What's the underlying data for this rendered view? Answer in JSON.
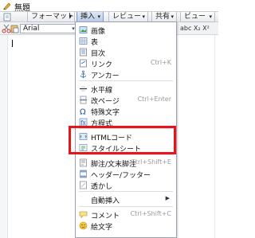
{
  "window": {
    "title": "無題"
  },
  "menubar": {
    "items": [
      {
        "label": "フォーマット"
      },
      {
        "label": "挿入"
      },
      {
        "label": "レビュー"
      },
      {
        "label": "共有"
      },
      {
        "label": "ビュー"
      }
    ]
  },
  "toolbar": {
    "font_value": "Arial",
    "right_text": "abc X₂ X²"
  },
  "insert_menu": {
    "items": [
      {
        "label": "画像",
        "shortcut": ""
      },
      {
        "label": "表",
        "shortcut": ""
      },
      {
        "label": "目次",
        "shortcut": ""
      },
      {
        "label": "リンク",
        "shortcut": "Ctrl+K"
      },
      {
        "label": "アンカー",
        "shortcut": ""
      },
      {
        "label": "水平線",
        "shortcut": ""
      },
      {
        "label": "改ページ",
        "shortcut": "Ctrl+Enter"
      },
      {
        "label": "特殊文字",
        "shortcut": ""
      },
      {
        "label": "方程式",
        "shortcut": ""
      },
      {
        "label": "HTMLコード",
        "shortcut": ""
      },
      {
        "label": "スタイルシート",
        "shortcut": ""
      },
      {
        "label": "脚注/文末脚注",
        "shortcut": "Ctrl+Shift+E"
      },
      {
        "label": "ヘッダー/フッター",
        "shortcut": ""
      },
      {
        "label": "透かし",
        "shortcut": ""
      },
      {
        "label": "自動挿入",
        "shortcut": ""
      },
      {
        "label": "コメント",
        "shortcut": "Ctrl+Shift+C"
      },
      {
        "label": "絵文字",
        "shortcut": ""
      }
    ]
  },
  "colors": {
    "highlight": "#e8141b",
    "menu_active": "#b8cbe8"
  }
}
